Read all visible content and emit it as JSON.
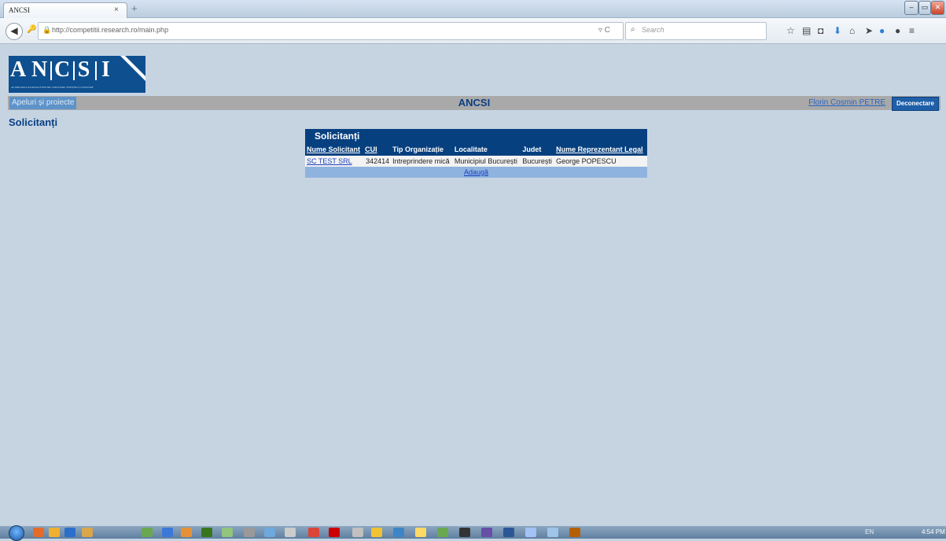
{
  "browser": {
    "tab_title": "ANCSI",
    "tab_close": "×",
    "new_tab": "+",
    "url": "http://competitii.research.ro/main.php",
    "search_placeholder": "Search",
    "reload_icon": "▿ C",
    "min_icon": "‒",
    "max_icon": "▭",
    "close_icon": "✕"
  },
  "header": {
    "logo_letters": [
      "A",
      "N",
      "C",
      "S",
      "I"
    ],
    "logo_tagline": "AUTORITATEA NAȚIONALĂ PENTRU CERCETARE ȘTIINȚIFICĂ ȘI INOVARE",
    "menu_item": "Apeluri și proiecte",
    "site_title": "ANCSI",
    "user_name": "Florin Cosmin PETRE",
    "logout_label": "Deconectare"
  },
  "page": {
    "title": "Solicitanți"
  },
  "panel": {
    "title": "Solicitanți",
    "columns": [
      "Nume Solicitant",
      "CUI",
      "Tip Organizație",
      "Localitate",
      "Judet",
      "Nume Reprezentant Legal"
    ],
    "rows": [
      {
        "name": "SC TEST SRL",
        "cui": "342414",
        "tip": "Intreprindere mică",
        "localitate": "Municipiul București",
        "judet": "București",
        "reprezentant": "George POPESCU"
      }
    ],
    "add_label": "Adaugă"
  },
  "taskbar": {
    "tray": "EN",
    "clock": "4:54 PM"
  },
  "colors": {
    "page_bg": "#c6d4e2",
    "brand_blue": "#07407f",
    "logo_blue": "#0d4f8f",
    "menubar_gray": "#a9a9a9",
    "link_blue": "#2a64c4"
  }
}
